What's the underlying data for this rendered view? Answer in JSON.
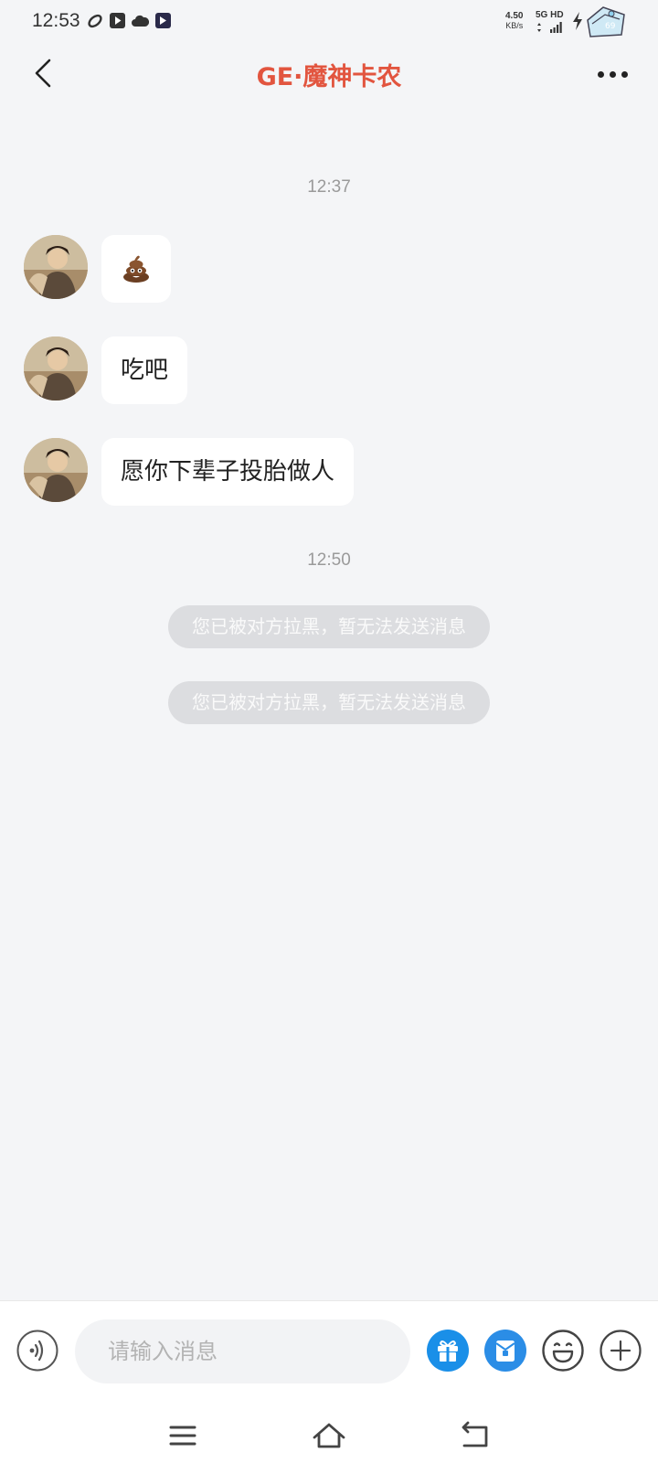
{
  "status_bar": {
    "time": "12:53",
    "speed_value": "4.50",
    "speed_unit": "KB/s",
    "network": "5G HD",
    "icons": [
      "chain-link-icon",
      "play-icon",
      "cloud-icon",
      "video-app-icon",
      "wifi-signal-icon",
      "cellular-signal-icon",
      "charging-icon",
      "battery-icon"
    ]
  },
  "header": {
    "title": "GE·魔神卡农",
    "title_color": "#e2553f"
  },
  "chat": {
    "timestamps": [
      "12:37",
      "12:50"
    ],
    "messages": [
      {
        "type": "emoji",
        "icon": "poop-emoji-icon"
      },
      {
        "type": "text",
        "text": "吃吧"
      },
      {
        "type": "text",
        "text": "愿你下辈子投胎做人"
      }
    ],
    "system_notices": [
      "您已被对方拉黑，暂无法发送消息",
      "您已被对方拉黑，暂无法发送消息"
    ]
  },
  "composer": {
    "placeholder": "请输入消息",
    "value": "",
    "gift_color": "#1a8fe8",
    "red_packet_color": "#2b8de6",
    "icons": [
      "voice-icon",
      "gift-icon",
      "red-packet-icon",
      "emoji-icon",
      "plus-icon"
    ]
  },
  "nav": {
    "icons": [
      "menu-icon",
      "home-icon",
      "back-nav-icon"
    ]
  }
}
